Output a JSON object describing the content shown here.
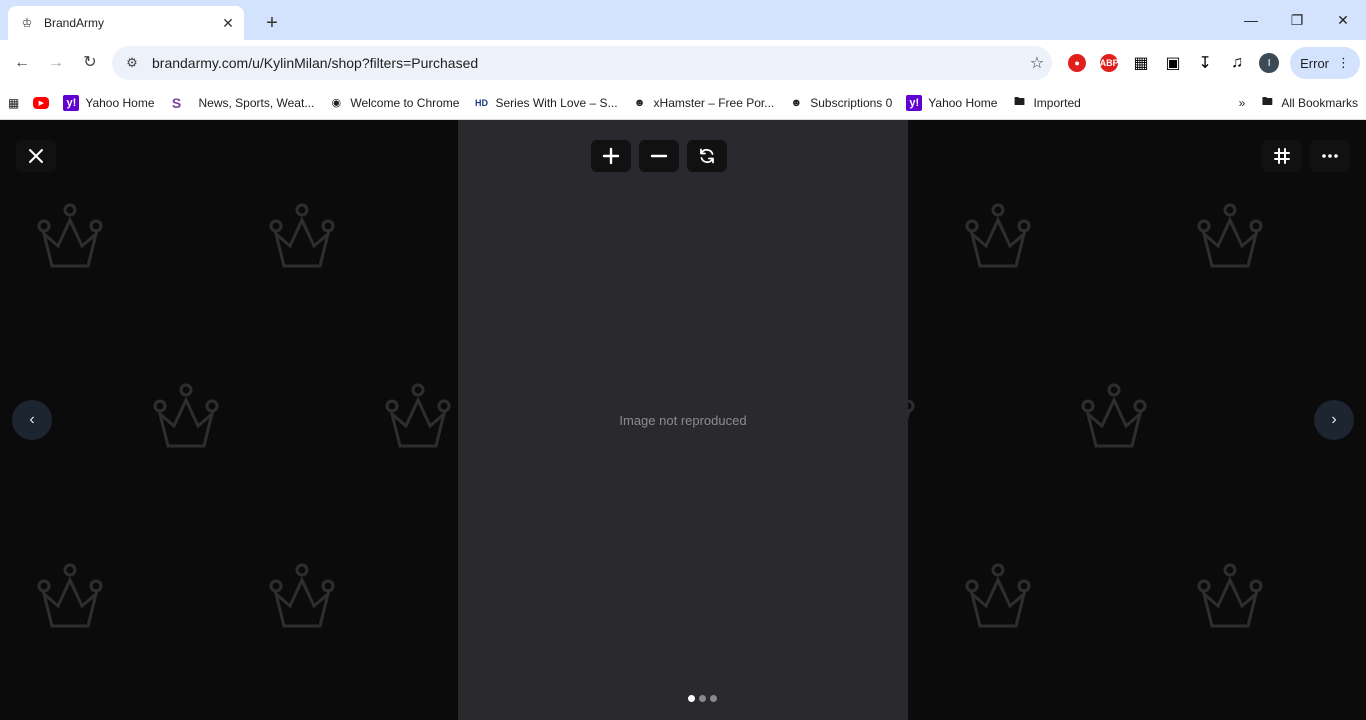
{
  "tab": {
    "title": "BrandArmy",
    "close_glyph": "✕"
  },
  "window": {
    "minimize": "—",
    "restore": "❐",
    "close": "✕"
  },
  "toolbar": {
    "url": "brandarmy.com/u/KylinMilan/shop?filters=Purchased",
    "error_label": "Error",
    "profile_initial": "I",
    "ext_abp": "ABP"
  },
  "bookmarks": [
    {
      "label": "",
      "icon": "youtube-icon"
    },
    {
      "label": "Yahoo Home",
      "icon": "yahoo-icon"
    },
    {
      "label": "",
      "icon": "s-icon"
    },
    {
      "label": "News, Sports, Weat...",
      "icon": ""
    },
    {
      "label": "Welcome to Chrome",
      "icon": "chrome-icon"
    },
    {
      "label": "Series With Love – S...",
      "icon": "hd-icon"
    },
    {
      "label": "xHamster – Free Por...",
      "icon": "xhamster-icon"
    },
    {
      "label": "Subscriptions 0",
      "icon": "xhamster-icon"
    },
    {
      "label": "Yahoo Home",
      "icon": "yahoo-icon"
    },
    {
      "label": "Imported",
      "icon": "folder-icon"
    }
  ],
  "all_bookmarks_label": "All Bookmarks",
  "viewer": {
    "image_placeholder": "Image not reproduced",
    "slide_count": 3,
    "active_slide": 1
  },
  "colors": {
    "accent_tab_strip": "#d3e3fd",
    "viewer_bg": "#0b0b0b"
  }
}
